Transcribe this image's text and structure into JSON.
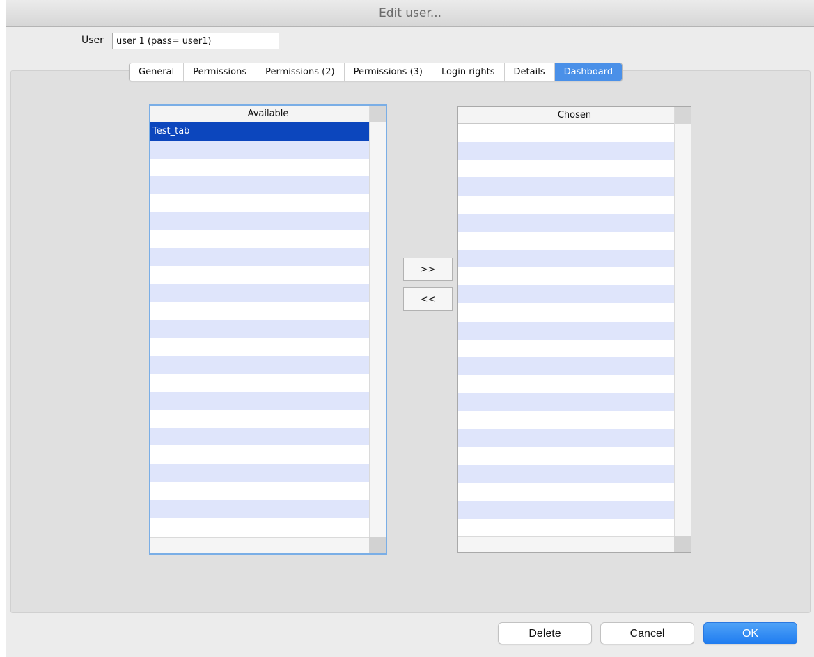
{
  "window": {
    "title": "Edit user..."
  },
  "user": {
    "label": "User",
    "value": "user 1 (pass= user1)"
  },
  "tabs": [
    {
      "label": "General",
      "active": false
    },
    {
      "label": "Permissions",
      "active": false
    },
    {
      "label": "Permissions (2)",
      "active": false
    },
    {
      "label": "Permissions (3)",
      "active": false
    },
    {
      "label": "Login rights",
      "active": false
    },
    {
      "label": "Details",
      "active": false
    },
    {
      "label": "Dashboard",
      "active": true
    }
  ],
  "available": {
    "header": "Available",
    "items": [
      "Test_tab"
    ],
    "selected_index": 0
  },
  "chosen": {
    "header": "Chosen",
    "items": []
  },
  "movers": {
    "add_label": ">>",
    "remove_label": "<<"
  },
  "buttons": {
    "delete": "Delete",
    "cancel": "Cancel",
    "ok": "OK"
  },
  "colors": {
    "selection": "#0c46bd",
    "stripe": "#dfe5fb",
    "accent": "#4a90e8"
  }
}
